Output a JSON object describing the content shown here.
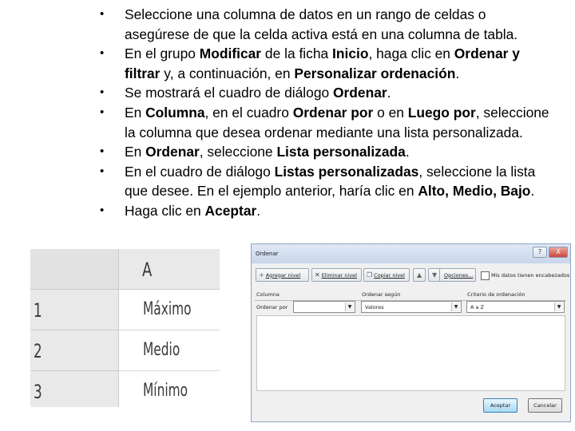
{
  "bullets": [
    [
      {
        "t": "Seleccione una columna de datos en un rango de celdas o",
        "b": false
      }
    ],
    [
      {
        "t": "asegúrese de que la celda activa está en una columna de tabla.",
        "b": false
      }
    ],
    [
      {
        "t": "En el grupo ",
        "b": false
      },
      {
        "t": "Modificar",
        "b": true
      },
      {
        "t": " de la ficha ",
        "b": false
      },
      {
        "t": "Inicio",
        "b": true
      },
      {
        "t": ", haga clic en ",
        "b": false
      },
      {
        "t": "Ordenar y",
        "b": true
      }
    ],
    [
      {
        "t": "filtrar",
        "b": true
      },
      {
        "t": " y, a continuación, en ",
        "b": false
      },
      {
        "t": "Personalizar ordenación",
        "b": true
      },
      {
        "t": ".",
        "b": false
      }
    ],
    [
      {
        "t": "Se mostrará el cuadro de diálogo ",
        "b": false
      },
      {
        "t": "Ordenar",
        "b": true
      },
      {
        "t": ".",
        "b": false
      }
    ],
    [
      {
        "t": "En ",
        "b": false
      },
      {
        "t": "Columna",
        "b": true
      },
      {
        "t": ", en el cuadro ",
        "b": false
      },
      {
        "t": "Ordenar por",
        "b": true
      },
      {
        "t": " o en ",
        "b": false
      },
      {
        "t": "Luego por",
        "b": true
      },
      {
        "t": ", seleccione",
        "b": false
      }
    ],
    [
      {
        "t": "la columna que desea ordenar mediante una lista personalizada.",
        "b": false
      }
    ],
    [
      {
        "t": "En ",
        "b": false
      },
      {
        "t": "Ordenar",
        "b": true
      },
      {
        "t": ", seleccione ",
        "b": false
      },
      {
        "t": "Lista personalizada",
        "b": true
      },
      {
        "t": ".",
        "b": false
      }
    ],
    [
      {
        "t": "En el cuadro de diálogo ",
        "b": false
      },
      {
        "t": "Listas personalizadas",
        "b": true
      },
      {
        "t": ", seleccione la lista",
        "b": false
      }
    ],
    [
      {
        "t": "que desee. En el ejemplo anterior, haría clic en ",
        "b": false
      },
      {
        "t": "Alto, Medio, Bajo",
        "b": true
      },
      {
        "t": ".",
        "b": false
      }
    ],
    [
      {
        "t": "Haga clic en ",
        "b": false
      },
      {
        "t": "Aceptar",
        "b": true
      },
      {
        "t": ".",
        "b": false
      }
    ]
  ],
  "bullet_starts": [
    0,
    2,
    4,
    5,
    7,
    8,
    10
  ],
  "bullet_char": "•",
  "spreadsheet": {
    "column_header": "A",
    "rows": [
      {
        "num": "1",
        "value": "Máximo"
      },
      {
        "num": "2",
        "value": "Medio"
      },
      {
        "num": "3",
        "value": "Mínimo"
      }
    ]
  },
  "dialog": {
    "title": "Ordenar",
    "help_glyph": "?",
    "close_glyph": "X",
    "buttons": {
      "add_level": "Agregar nivel",
      "delete_level": "Eliminar nivel",
      "copy_level": "Copiar nivel",
      "options": "Opciones...",
      "ok": "Aceptar",
      "cancel": "Cancelar"
    },
    "icons": {
      "add": "+",
      "delete": "✕",
      "copy": "❐",
      "up": "▲",
      "down": "▼"
    },
    "headers_checkbox": "Mis datos tienen encabezados",
    "columns": {
      "column": "Columna",
      "sort_on": "Ordenar según",
      "order": "Criterio de ordenación"
    },
    "row": {
      "label": "Ordenar por",
      "column_value": "",
      "sort_on_value": "Valores",
      "order_value": "A a Z"
    }
  }
}
